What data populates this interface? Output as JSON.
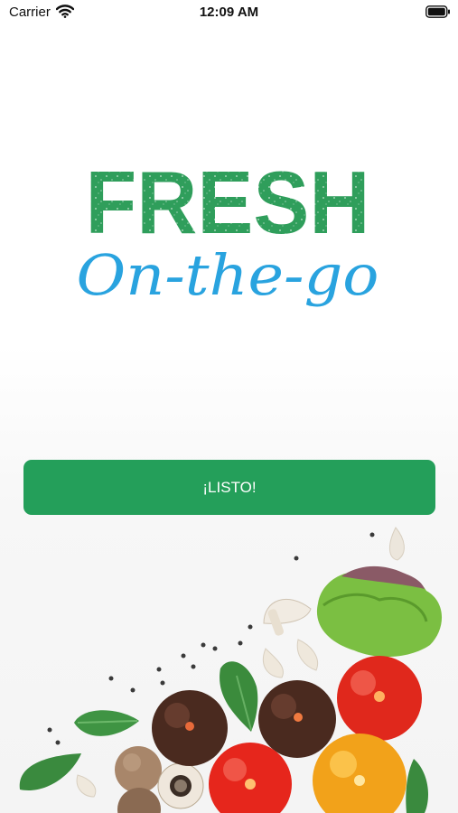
{
  "status_bar": {
    "carrier": "Carrier",
    "time": "12:09 AM",
    "wifi_icon": "wifi-icon",
    "battery_icon": "battery-icon"
  },
  "logo": {
    "word1": "FRESH",
    "word2": "On-the-go",
    "green": "#2f9e5b",
    "blue": "#29a3df"
  },
  "primary_button": {
    "label": "¡LISTO!",
    "color": "#249f5a"
  },
  "decoration": {
    "illustration": "vegetables-illustration"
  }
}
